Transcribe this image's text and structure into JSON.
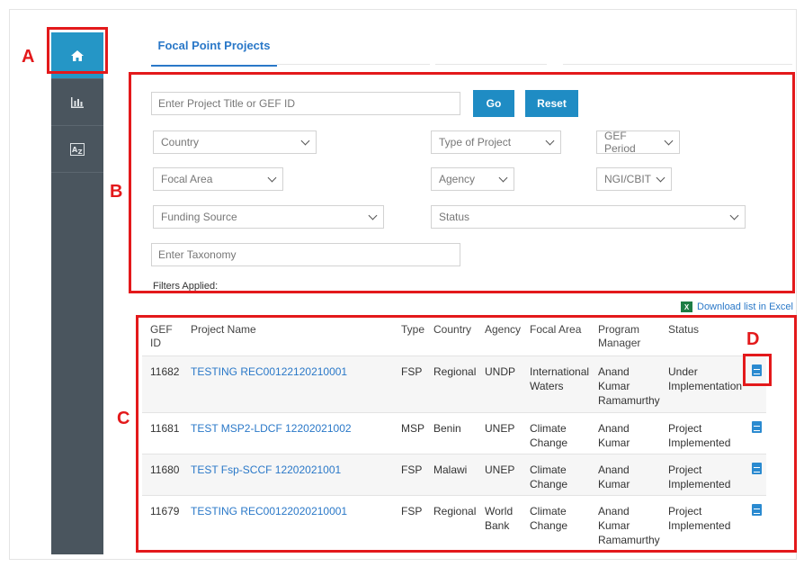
{
  "tabs": {
    "active": "Focal Point Projects"
  },
  "filters": {
    "search_placeholder": "Enter Project Title or GEF ID",
    "go": "Go",
    "reset": "Reset",
    "country": "Country",
    "type_of_project": "Type of Project",
    "gef_period": "GEF Period",
    "focal_area": "Focal Area",
    "agency": "Agency",
    "ngi_cbit": "NGI/CBIT",
    "funding_source": "Funding Source",
    "status": "Status",
    "taxonomy_placeholder": "Enter Taxonomy",
    "filters_applied": "Filters Applied:"
  },
  "download": {
    "label": "Download list in Excel",
    "icon": "excel-icon"
  },
  "table": {
    "headers": {
      "gef_id_1": "GEF",
      "gef_id_2": "ID",
      "project_name": "Project Name",
      "type": "Type",
      "country": "Country",
      "agency": "Agency",
      "focal_area": "Focal Area",
      "pm_1": "Program",
      "pm_2": "Manager",
      "status": "Status"
    },
    "rows": [
      {
        "id": "11682",
        "name": "TESTING REC00122120210001",
        "type": "FSP",
        "country": "Regional",
        "agency_1": "UNDP",
        "agency_2": "",
        "focal_1": "International",
        "focal_2": "Waters",
        "pm_1": "Anand",
        "pm_2": "Kumar",
        "pm_3": "Ramamurthy",
        "status_1": "Under",
        "status_2": "Implementation"
      },
      {
        "id": "11681",
        "name": "TEST MSP2-LDCF 12202021002",
        "type": "MSP",
        "country": "Benin",
        "agency_1": "UNEP",
        "agency_2": "",
        "focal_1": "Climate",
        "focal_2": "Change",
        "pm_1": "Anand",
        "pm_2": "Kumar",
        "pm_3": "",
        "status_1": "Project",
        "status_2": "Implemented"
      },
      {
        "id": "11680",
        "name": "TEST Fsp-SCCF 12202021001",
        "type": "FSP",
        "country": "Malawi",
        "agency_1": "UNEP",
        "agency_2": "",
        "focal_1": "Climate",
        "focal_2": "Change",
        "pm_1": "Anand",
        "pm_2": "Kumar",
        "pm_3": "",
        "status_1": "Project",
        "status_2": "Implemented"
      },
      {
        "id": "11679",
        "name": "TESTING REC00122020210001",
        "type": "FSP",
        "country": "Regional",
        "agency_1": "World",
        "agency_2": "Bank",
        "focal_1": "Climate",
        "focal_2": "Change",
        "pm_1": "Anand",
        "pm_2": "Kumar",
        "pm_3": "Ramamurthy",
        "status_1": "Project",
        "status_2": "Implemented"
      }
    ]
  },
  "annotations": {
    "a": "A",
    "b": "B",
    "c": "C",
    "d": "D"
  },
  "sidebar": {
    "items": [
      "home-icon",
      "bar-chart-icon",
      "sort-az-icon"
    ]
  },
  "colors": {
    "sidebar": "#4a555e",
    "active": "#2596c6",
    "accent": "#2a78c8",
    "annotation": "#e3191b"
  }
}
